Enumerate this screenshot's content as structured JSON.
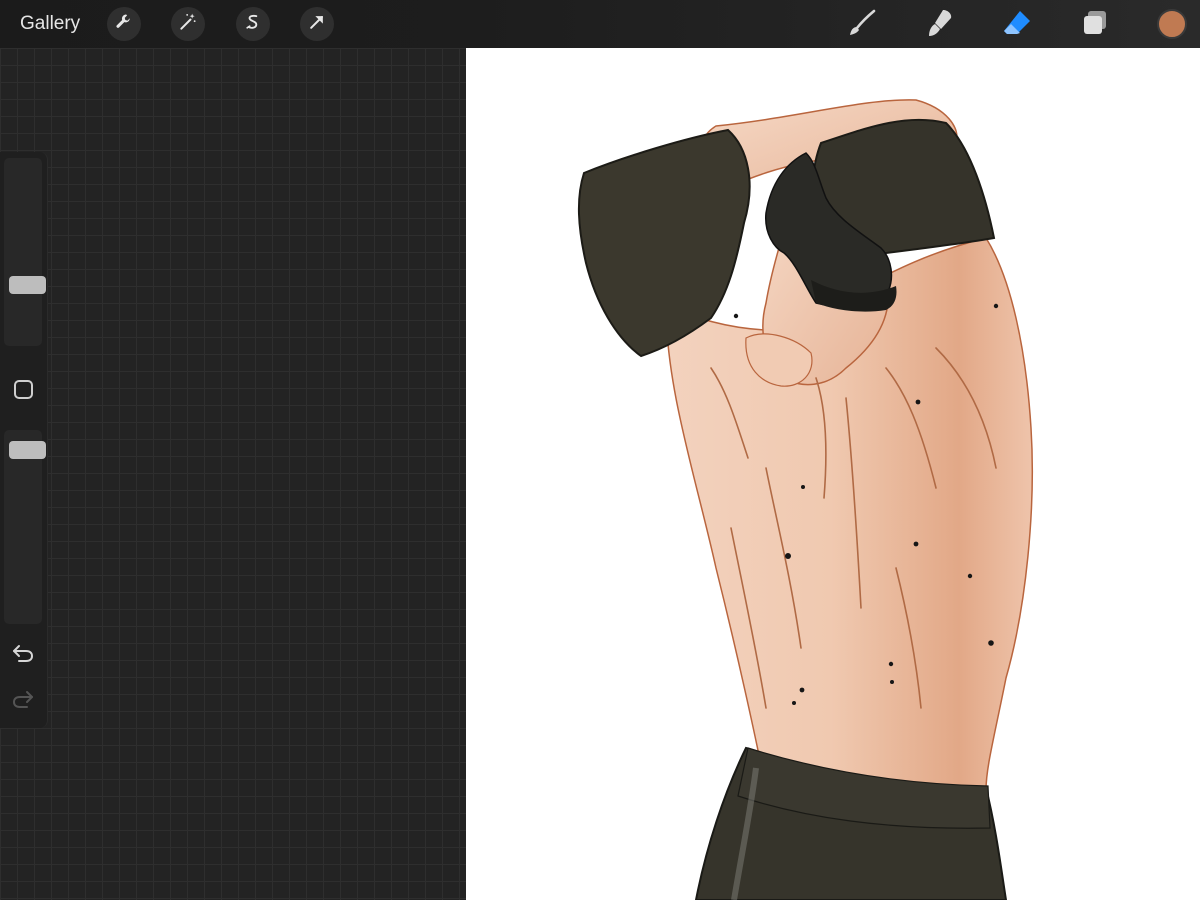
{
  "topbar": {
    "gallery_label": "Gallery",
    "left_tools": [
      {
        "name": "actions",
        "icon": "wrench-icon"
      },
      {
        "name": "adjustments",
        "icon": "magic-wand-icon"
      },
      {
        "name": "selection",
        "icon": "selection-s-icon"
      },
      {
        "name": "transform",
        "icon": "arrow-cursor-icon"
      }
    ],
    "right_tools": [
      {
        "name": "brush",
        "icon": "brush-icon",
        "active": false
      },
      {
        "name": "smudge",
        "icon": "smudge-icon",
        "active": false
      },
      {
        "name": "eraser",
        "icon": "eraser-icon",
        "active": true
      },
      {
        "name": "layers",
        "icon": "layers-icon",
        "active": false
      }
    ],
    "active_color": "#c07a52",
    "accent_color": "#1f8cff"
  },
  "sidebar": {
    "brush_size_level": 0.3,
    "opacity_level": 0.95,
    "modify_icon": "square-modify-icon",
    "undo_icon": "undo-icon",
    "redo_icon": "redo-icon"
  }
}
